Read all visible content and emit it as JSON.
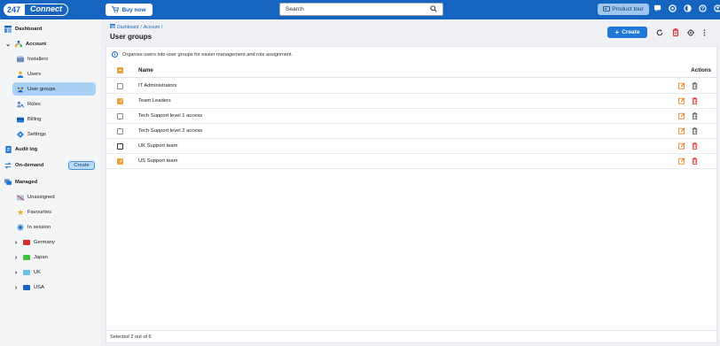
{
  "app": {
    "logo_a": "247",
    "logo_b": "Connect",
    "buy_label": "Buy now",
    "search_placeholder": "Search",
    "tour_label": "Product tour",
    "colors": {
      "brand": "#1565c0",
      "accent": "#e8a33c",
      "danger": "#d32f2f"
    }
  },
  "sidebar": {
    "dashboard": "Dashboard",
    "account": "Account",
    "installers": "Installers",
    "users": "Users",
    "user_groups": "User groups",
    "roles": "Roles",
    "billing": "Billing",
    "settings": "Settings",
    "audit_log": "Audit log",
    "on_demand": "On-demand",
    "create": "Create",
    "managed": "Managed",
    "unassigned": "Unassigned",
    "favourites": "Favourites",
    "in_session": "In session",
    "folders": [
      {
        "label": "Germany",
        "color": "#d32f2f"
      },
      {
        "label": "Japan",
        "color": "#43c23d"
      },
      {
        "label": "UK",
        "color": "#6cc0ea"
      },
      {
        "label": "USA",
        "color": "#1565c0"
      }
    ]
  },
  "main": {
    "breadcrumb_1": "Dashboard",
    "breadcrumb_sep": "/",
    "breadcrumb_2": "Account",
    "breadcrumb_sep2": "/",
    "title": "User groups",
    "create_label": "Create",
    "info_text": "Organise users into user groups for easier management and role assignment.",
    "col_name": "Name",
    "col_actions": "Actions",
    "rows": [
      {
        "name": "IT Administrators",
        "checked": false,
        "deletable": false
      },
      {
        "name": "Team Leaders",
        "checked": true,
        "deletable": true
      },
      {
        "name": "Tech Support level 1 access",
        "checked": false,
        "deletable": false
      },
      {
        "name": "Tech Support level 2 access",
        "checked": false,
        "deletable": false
      },
      {
        "name": "UK Support team",
        "checked": false,
        "deletable": true
      },
      {
        "name": "US Support team",
        "checked": true,
        "deletable": true
      }
    ],
    "footer": "Selected 2 out of 6"
  }
}
